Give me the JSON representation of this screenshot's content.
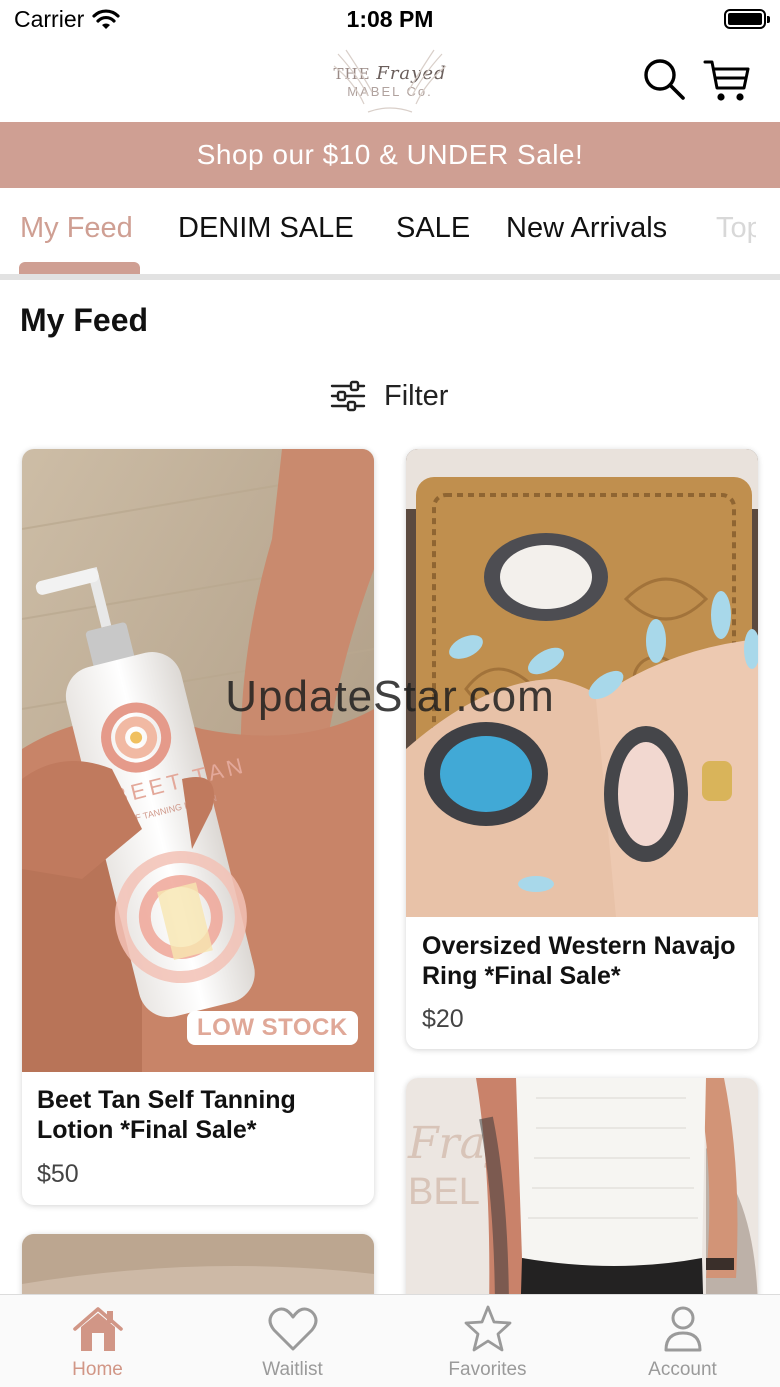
{
  "status_bar": {
    "carrier": "Carrier",
    "time": "1:08 PM"
  },
  "header": {
    "logo": {
      "line1_prefix": "THE",
      "line1_script": "Frayed",
      "line2": "MABEL Co."
    },
    "search_icon": "search-icon",
    "cart_icon": "cart-icon"
  },
  "promo_banner": {
    "text": "Shop our $10 & UNDER Sale!"
  },
  "tabs": [
    {
      "label": "My Feed",
      "active": true
    },
    {
      "label": "DENIM SALE",
      "active": false
    },
    {
      "label": "SALE",
      "active": false
    },
    {
      "label": "New Arrivals",
      "active": false
    },
    {
      "label": "Top",
      "active": false
    }
  ],
  "feed": {
    "title": "My Feed",
    "filter_label": "Filter",
    "products": [
      {
        "name": "Beet Tan Self Tanning Lotion *Final Sale*",
        "price": "$50",
        "badge": "LOW STOCK"
      },
      {
        "name": "Oversized Western Navajo Ring *Final Sale*",
        "price": "$20",
        "badge": ""
      },
      {
        "name": "",
        "price": "",
        "badge": ""
      },
      {
        "name": "",
        "price": "",
        "badge": ""
      }
    ]
  },
  "product_image_text": {
    "bottle_brand": "BEET TAN",
    "bottle_subtitle": "SELF TANNING LOTION",
    "wall_sign_line1": "Fraye",
    "wall_sign_line2": "BEL C"
  },
  "watermark": "UpdateStar.com",
  "tab_bar": [
    {
      "label": "Home",
      "icon": "home-icon",
      "active": true
    },
    {
      "label": "Waitlist",
      "icon": "heart-icon",
      "active": false
    },
    {
      "label": "Favorites",
      "icon": "star-icon",
      "active": false
    },
    {
      "label": "Account",
      "icon": "person-icon",
      "active": false
    }
  ],
  "colors": {
    "accent": "#cf9f93",
    "tab_active": "#d19686",
    "badge_text": "#e0a898"
  }
}
